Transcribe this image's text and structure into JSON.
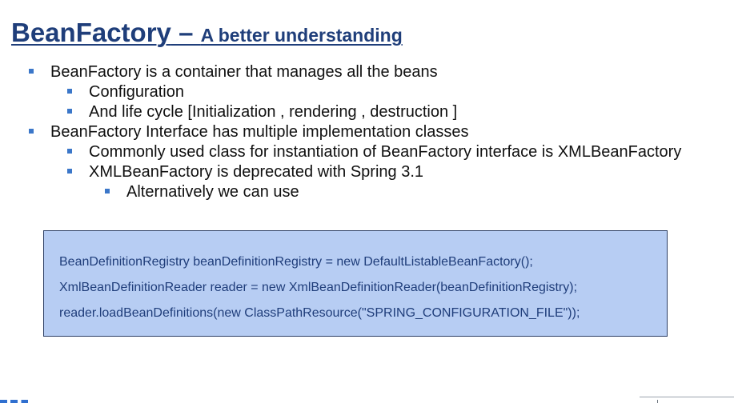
{
  "slide": {
    "title_main": "BeanFactory",
    "title_dash": " – ",
    "title_sub": "A better understanding"
  },
  "bullets": [
    {
      "text": "BeanFactory is a container that manages all the beans",
      "level": 1
    },
    {
      "text": "Configuration",
      "level": 2
    },
    {
      "text": "And life cycle [Initialization , rendering , destruction ]",
      "level": 2
    },
    {
      "text": "BeanFactory Interface has multiple implementation classes",
      "level": 1
    },
    {
      "text": "Commonly used class for instantiation of BeanFactory interface is XMLBeanFactory",
      "level": 2
    },
    {
      "text": " XMLBeanFactory  is deprecated with Spring 3.1",
      "level": 2
    },
    {
      "text": "Alternatively we can use",
      "level": 3
    }
  ],
  "code_box": {
    "lines": [
      "BeanDefinitionRegistry beanDefinitionRegistry = new DefaultListableBeanFactory();",
      "XmlBeanDefinitionReader reader = new XmlBeanDefinitionReader(beanDefinitionRegistry);",
      "reader.loadBeanDefinitions(new ClassPathResource(\"SPRING_CONFIGURATION_FILE\"));"
    ]
  },
  "colors": {
    "title": "#1f3e7a",
    "bullet_marker": "#3b77c9",
    "code_box_background": "#b7cdf3",
    "code_text": "#1f3d7a"
  }
}
